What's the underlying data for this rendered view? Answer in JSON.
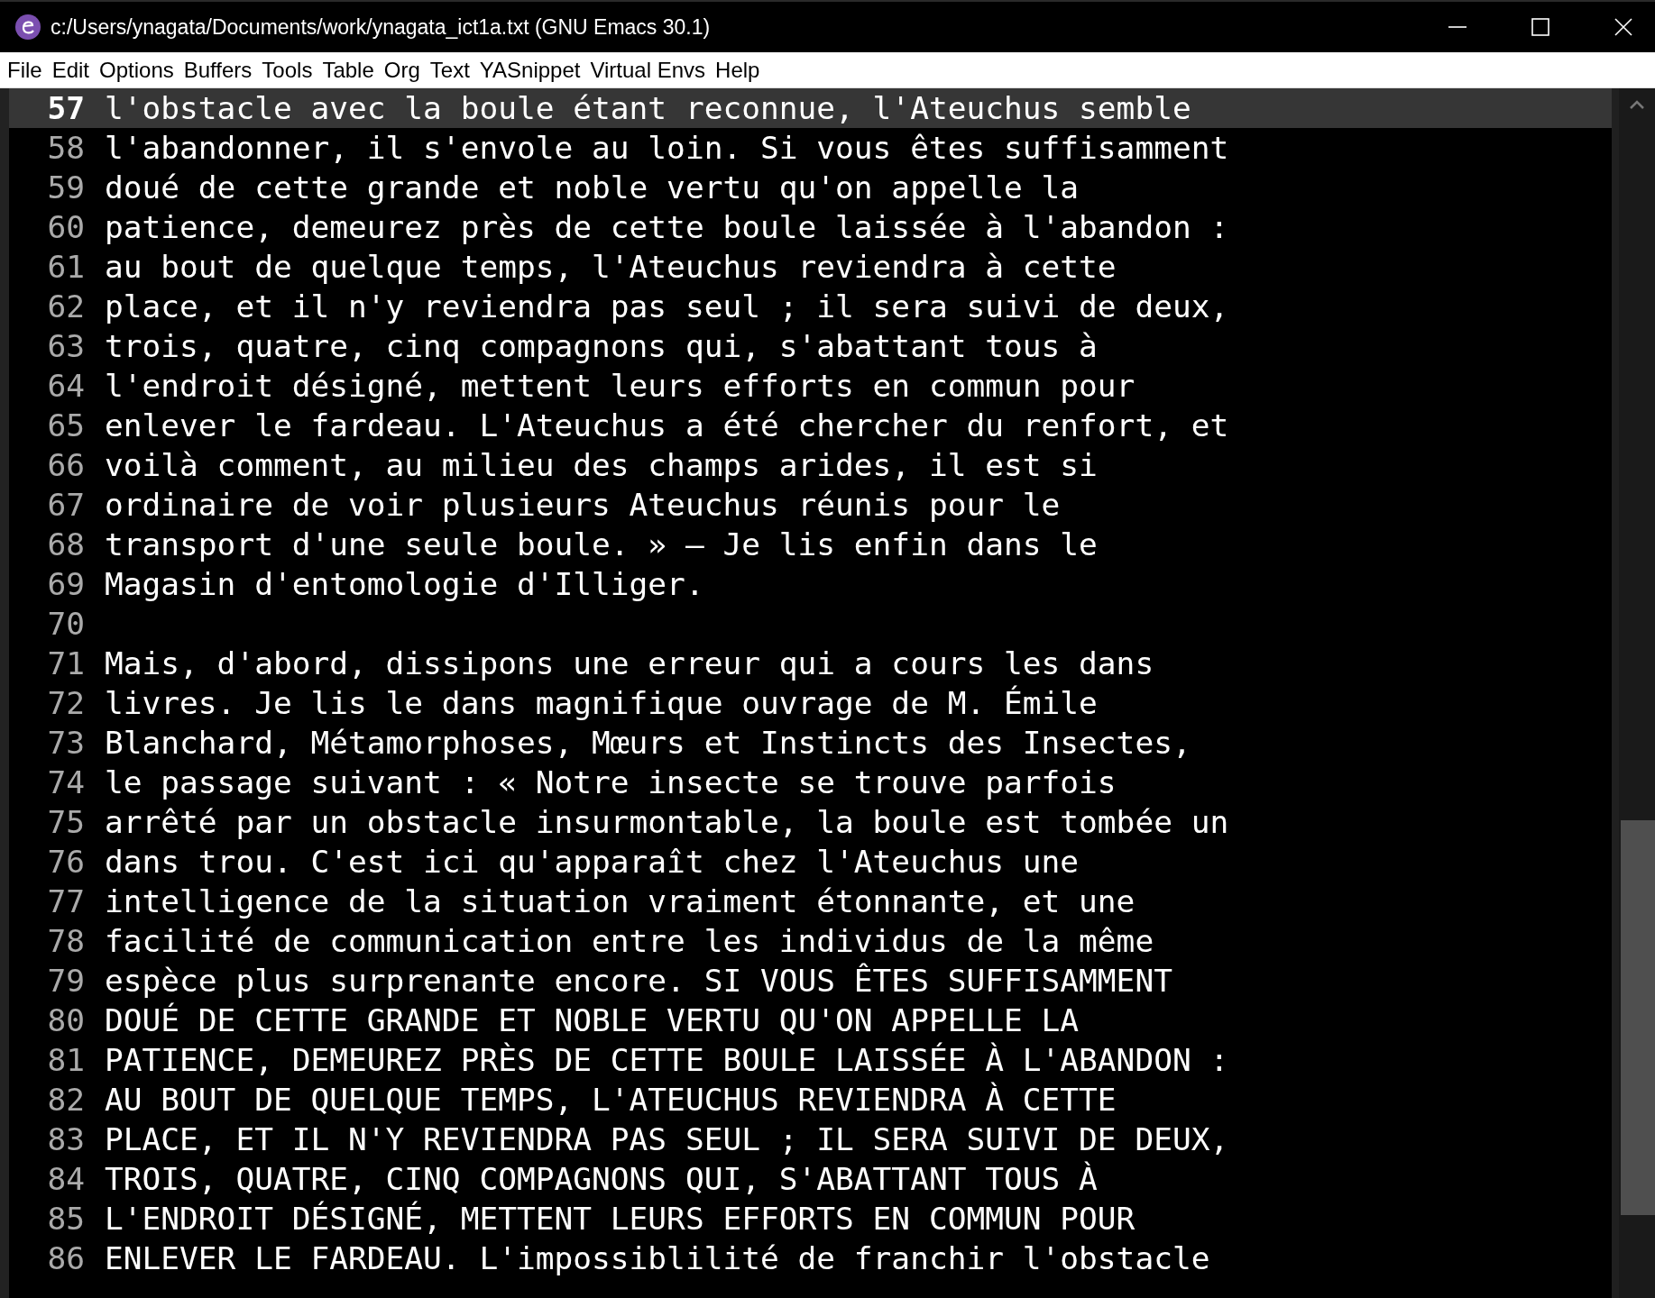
{
  "window": {
    "title": "c:/Users/ynagata/Documents/work/ynagata_ict1a.txt (GNU Emacs 30.1)"
  },
  "menu": [
    "File",
    "Edit",
    "Options",
    "Buffers",
    "Tools",
    "Table",
    "Org",
    "Text",
    "YASnippet",
    "Virtual Envs",
    "Help"
  ],
  "lines": [
    {
      "number": "57",
      "text": "l'obstacle avec la boule étant reconnue, l'Ateuchus semble",
      "current": true
    },
    {
      "number": "58",
      "text": "l'abandonner, il s'envole au loin. Si vous êtes suffisamment",
      "current": false
    },
    {
      "number": "59",
      "text": "doué de cette grande et noble vertu qu'on appelle la",
      "current": false
    },
    {
      "number": "60",
      "text": "patience, demeurez près de cette boule laissée à l'abandon :",
      "current": false
    },
    {
      "number": "61",
      "text": "au bout de quelque temps, l'Ateuchus reviendra à cette",
      "current": false
    },
    {
      "number": "62",
      "text": "place, et il n'y reviendra pas seul ; il sera suivi de deux,",
      "current": false
    },
    {
      "number": "63",
      "text": "trois, quatre, cinq compagnons qui, s'abattant tous à",
      "current": false
    },
    {
      "number": "64",
      "text": "l'endroit désigné, mettent leurs efforts en commun pour",
      "current": false
    },
    {
      "number": "65",
      "text": "enlever le fardeau. L'Ateuchus a été chercher du renfort, et",
      "current": false
    },
    {
      "number": "66",
      "text": "voilà comment, au milieu des champs arides, il est si",
      "current": false
    },
    {
      "number": "67",
      "text": "ordinaire de voir plusieurs Ateuchus réunis pour le",
      "current": false
    },
    {
      "number": "68",
      "text": "transport d'une seule boule. » — Je lis enfin dans le",
      "current": false
    },
    {
      "number": "69",
      "text": "Magasin d'entomologie d'Illiger.",
      "current": false
    },
    {
      "number": "70",
      "current": false
    },
    {
      "number": "71",
      "text": "Mais, d'abord, dissipons une erreur qui a cours les dans",
      "current": false
    },
    {
      "number": "72",
      "text": "livres. Je lis le dans magnifique ouvrage de M. Émile",
      "current": false
    },
    {
      "number": "73",
      "text": "Blanchard, Métamorphoses, Mœurs et Instincts des Insectes,",
      "current": false
    },
    {
      "number": "74",
      "text": "le passage suivant : « Notre insecte se trouve parfois",
      "current": false
    },
    {
      "number": "75",
      "text": "arrêté par un obstacle insurmontable, la boule est tombée un",
      "current": false
    },
    {
      "number": "76",
      "text": "dans trou. C'est ici qu'apparaît chez l'Ateuchus une",
      "current": false
    },
    {
      "number": "77",
      "text": "intelligence de la situation vraiment étonnante, et une",
      "current": false
    },
    {
      "number": "78",
      "text": "facilité de communication entre les individus de la même",
      "current": false
    },
    {
      "number": "79",
      "text": "espèce plus surprenante encore. SI VOUS ÊTES SUFFISAMMENT",
      "current": false
    },
    {
      "number": "80",
      "text": "DOUÉ DE CETTE GRANDE ET NOBLE VERTU QU'ON APPELLE LA",
      "current": false
    },
    {
      "number": "81",
      "text": "PATIENCE, DEMEUREZ PRÈS DE CETTE BOULE LAISSÉE À L'ABANDON :",
      "current": false
    },
    {
      "number": "82",
      "text": "AU BOUT DE QUELQUE TEMPS, L'ATEUCHUS REVIENDRA À CETTE",
      "current": false
    },
    {
      "number": "83",
      "text": "PLACE, ET IL N'Y REVIENDRA PAS SEUL ; IL SERA SUIVI DE DEUX,",
      "current": false
    },
    {
      "number": "84",
      "text": "TROIS, QUATRE, CINQ COMPAGNONS QUI, S'ABATTANT TOUS À",
      "current": false
    },
    {
      "number": "85",
      "text": "L'ENDROIT DÉSIGNÉ, METTENT LEURS EFFORTS EN COMMUN POUR",
      "current": false
    },
    {
      "number": "86",
      "text": "ENLEVER LE FARDEAU. L'impossiblilité de franchir l'obstacle",
      "current": false
    }
  ]
}
